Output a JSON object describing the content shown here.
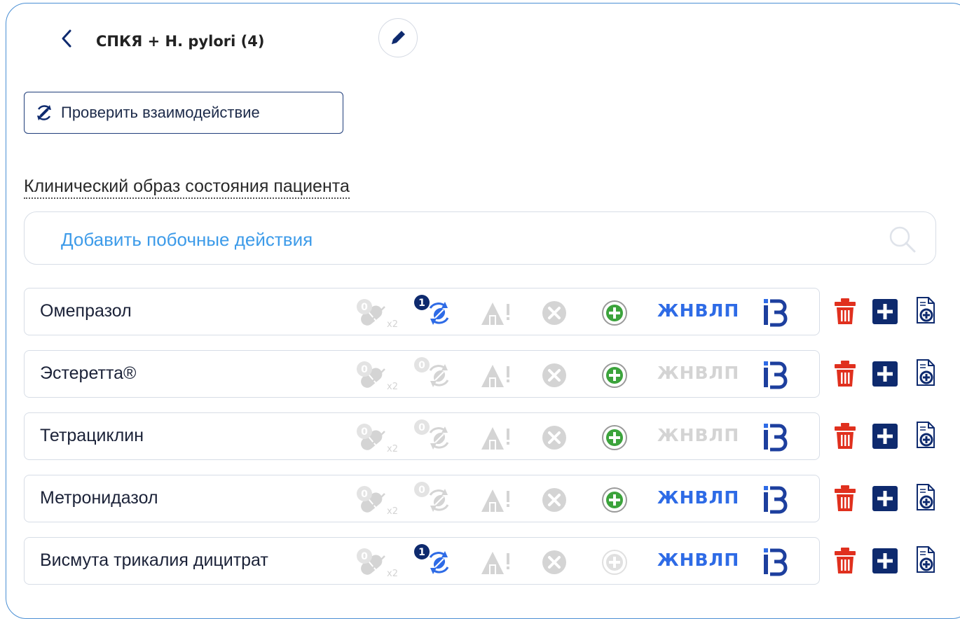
{
  "header": {
    "title": "СПКЯ + H. pylori (4)"
  },
  "toolbar": {
    "check_interaction_label": "Проверить взаимодействие"
  },
  "section": {
    "title": "Клинический образ состояния пациента"
  },
  "search": {
    "placeholder": "Добавить побочные действия"
  },
  "colors": {
    "accent_blue": "#2e6be6",
    "navy": "#0e2a6e",
    "green": "#3ba33b",
    "red": "#e0301e",
    "disabled": "#d4d4d4"
  },
  "drugs": [
    {
      "name": "Омепразол",
      "interaction_count": "1",
      "interaction_active": true,
      "green_plus_active": true,
      "zhnvlp_label": "ЖНВЛП",
      "zhnvlp_active": true
    },
    {
      "name": "Эстеретта®",
      "interaction_count": "0",
      "interaction_active": false,
      "green_plus_active": true,
      "zhnvlp_label": "ЖНВЛП",
      "zhnvlp_active": false
    },
    {
      "name": "Тетрациклин",
      "interaction_count": "0",
      "interaction_active": false,
      "green_plus_active": true,
      "zhnvlp_label": "ЖНВЛП",
      "zhnvlp_active": false
    },
    {
      "name": "Метронидазол",
      "interaction_count": "0",
      "interaction_active": false,
      "green_plus_active": true,
      "zhnvlp_label": "ЖНВЛП",
      "zhnvlp_active": true
    },
    {
      "name": "Висмута трикалия дицитрат",
      "interaction_count": "1",
      "interaction_active": true,
      "green_plus_active": false,
      "zhnvlp_label": "ЖНВЛП",
      "zhnvlp_active": true
    }
  ],
  "dose_badge": {
    "count": "0",
    "multiplier": "x2"
  }
}
